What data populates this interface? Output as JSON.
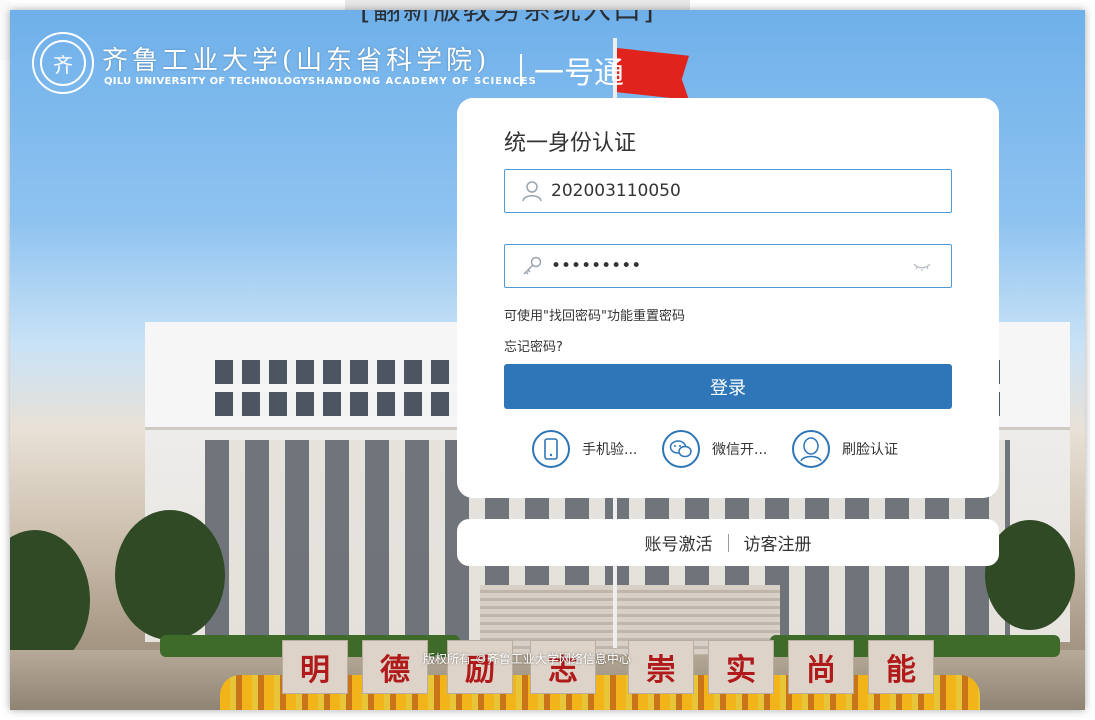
{
  "header": {
    "top_text": "[翻新版教务系统入口]",
    "logo_glyph": "齐",
    "school_name_cn": "齐鲁工业大学(山东省科学院)",
    "school_name_en": "QILU UNIVERSITY OF TECHNOLOGY",
    "academy_en": "SHANDONG ACADEMY OF SCIENCES",
    "one_pass": "一号通"
  },
  "login": {
    "title": "统一身份认证",
    "username": "202003110050",
    "password": "•••••••••",
    "hint": "可使用\"找回密码\"功能重置密码",
    "forgot": "忘记密码?",
    "submit_label": "登录",
    "alt_methods": [
      {
        "label": "手机验...",
        "icon": "phone-icon"
      },
      {
        "label": "微信开...",
        "icon": "wechat-icon"
      },
      {
        "label": "刷脸认证",
        "icon": "face-icon"
      }
    ]
  },
  "footer_links": {
    "activate": "账号激活",
    "visitor": "访客注册"
  },
  "copyright": "版权所有 ©齐鲁工业大学网络信息中心",
  "motto": [
    "明",
    "德",
    "励",
    "志",
    "崇",
    "实",
    "尚",
    "能"
  ],
  "colors": {
    "accent": "#2e76b8",
    "field_border": "#4e9bd6",
    "flag": "#e0241d"
  }
}
